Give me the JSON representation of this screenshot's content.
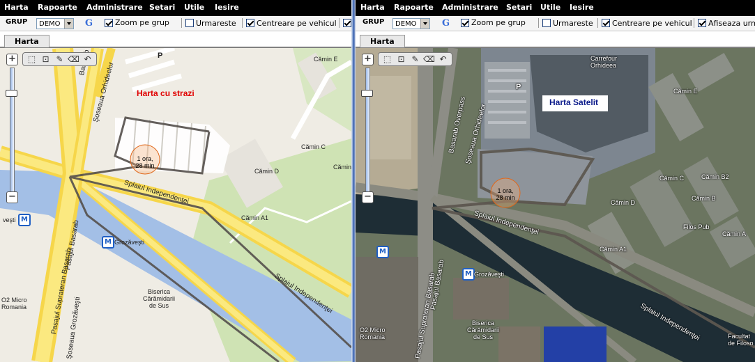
{
  "menu": [
    "Harta",
    "Rapoarte",
    "Administrare",
    "Setari",
    "Utile",
    "Iesire"
  ],
  "toolbar": {
    "group_label": "GRUP",
    "group_value": "DEMO",
    "g_icon": "G",
    "zoom_label": "Zoom pe grup",
    "follow_label": "Urmareste",
    "center_label": "Centreare pe vehicul",
    "show_label": "Afiseaza urm"
  },
  "tab_label": "Harta",
  "left_map": {
    "title": "Harta cu strazi",
    "title_color": "#e00000",
    "stop_line1": "1 ora,",
    "stop_line2": "28 min",
    "labels": {
      "camin_e": "Cămin E",
      "camin_c": "Cămin C",
      "camin_d": "Cămin D",
      "camin_a1": "Cămin A1",
      "camin_cut": "Cămin",
      "parking": "P",
      "basarab": "Basarab",
      "sos_orhideelor": "Şoseaua Orhideelor",
      "splaiul": "Splaiul Independenţei",
      "splaiul2": "Splaiul Independenţei",
      "pasajul_supra": "Pasajul Suprateran Basarab",
      "pasajul_b": "Pasajul Basarab",
      "sos_grozavesti": "Şoseaua Grozăveşti",
      "grozavesti_metro": "Grozăveşti",
      "vesti": "veşti",
      "biserica": "Biserica\nCărămidarii\nde Sus",
      "o2": "O2 Micro\nRomania"
    }
  },
  "right_map": {
    "title": "Harta Satelit",
    "title_color": "#0b1a8a",
    "stop_line1": "1 ora,",
    "stop_line2": "28 min",
    "labels": {
      "carrefour": "Carrefour\nOrhideea",
      "camin_e": "Cămin E",
      "camin_c": "Cămin C",
      "camin_b2": "Cămin B2",
      "camin_b": "Cămin B",
      "camin_d": "Cămin D",
      "camin_a1": "Cămin A1",
      "camin_a": "Cămin A",
      "filos_pub": "Filos Pub",
      "parking": "P",
      "basarab_overpass": "Basarab Overpass",
      "sos_orhideelor": "Şoseaua Orhideelor",
      "splaiul": "Splaiul Independenţei",
      "splaiul2": "Splaiul Independenţei",
      "pasajul_supra": "Pasajul Suprateran Basarab",
      "pasajul_b": "Pasajul Basarab",
      "grozavesti": "Grozăveşti",
      "sos_grozavesti": "Şoseaua Grozăveşti",
      "biserica": "Biserica\nCărămidarii\nde Sus",
      "o2": "O2 Micro\nRomania",
      "facultatea": "Facultat\nde Filoso"
    }
  },
  "icons": {
    "zoom_in": "plus-icon",
    "zoom_out": "minus-icon",
    "tools": [
      "zoom-box-icon",
      "zoom-extent-icon",
      "measure-icon",
      "broom-icon",
      "undo-icon"
    ]
  }
}
